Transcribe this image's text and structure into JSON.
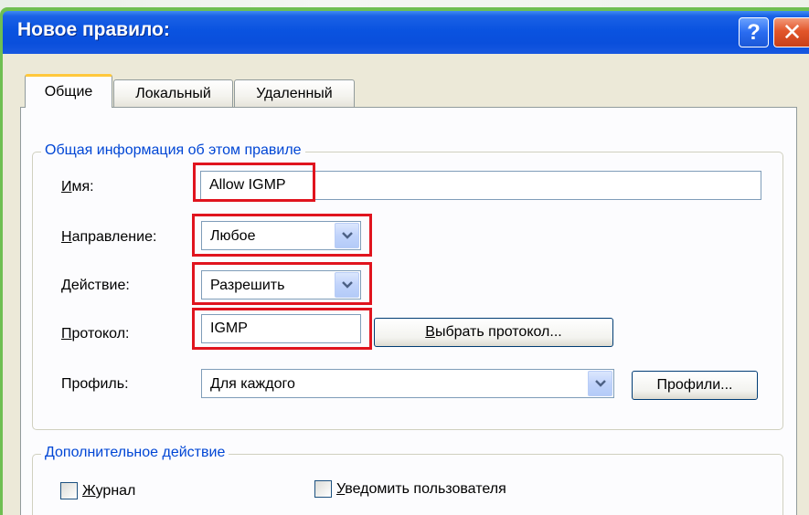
{
  "window": {
    "title": "Новое правило:",
    "help_glyph": "?",
    "close_glyph": "✕"
  },
  "tabs": [
    {
      "label": "Общие",
      "active": true
    },
    {
      "label": "Локальный",
      "active": false
    },
    {
      "label": "Удаленный",
      "active": false
    }
  ],
  "general_group": {
    "legend": "Общая информация об этом правиле",
    "name": {
      "label_ul": "И",
      "label_rest": "мя:",
      "value": "Allow IGMP"
    },
    "direction": {
      "label_ul": "Н",
      "label_rest": "аправление:",
      "value": "Любое"
    },
    "action": {
      "label_ul": "Д",
      "label_rest": "ействие:",
      "value": "Разрешить"
    },
    "protocol": {
      "label_ul": "П",
      "label_rest": "ротокол:",
      "value": "IGMP",
      "button_ul": "В",
      "button_rest": "ыбрать протокол..."
    },
    "profile": {
      "label": "Профиль:",
      "value": "Для каждого",
      "button": "Профили..."
    }
  },
  "extra_group": {
    "legend": "Дополнительное действие",
    "log": {
      "label_ul": "Ж",
      "label_rest": "урнал",
      "checked": false
    },
    "notify": {
      "label_ul": "У",
      "label_rest": "ведомить пользователя",
      "checked": false
    }
  },
  "colors": {
    "highlight": "#e0141e",
    "titlebar": "#0a53e0",
    "legend_text": "#0046d5"
  },
  "icons": {
    "help": "question-mark-icon",
    "close": "close-x-icon",
    "dropdown": "chevron-down-icon"
  }
}
